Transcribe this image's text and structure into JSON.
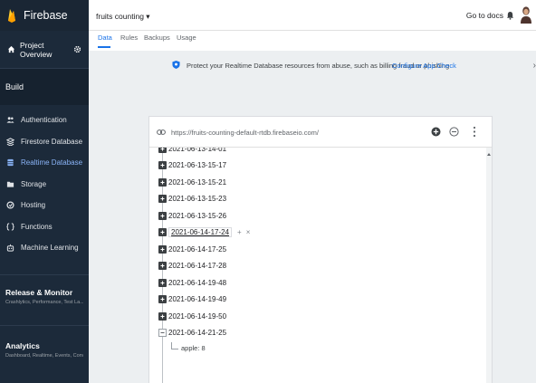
{
  "sidebar": {
    "brand": "Firebase",
    "project_overview": "Project Overview",
    "build_title": "Build",
    "items": [
      {
        "label": "Authentication",
        "icon": "people-icon"
      },
      {
        "label": "Firestore Database",
        "icon": "firestore-icon"
      },
      {
        "label": "Realtime Database",
        "icon": "database-icon",
        "active": true
      },
      {
        "label": "Storage",
        "icon": "folder-icon"
      },
      {
        "label": "Hosting",
        "icon": "hosting-icon"
      },
      {
        "label": "Functions",
        "icon": "functions-icon"
      },
      {
        "label": "Machine Learning",
        "icon": "robot-icon"
      }
    ],
    "release": {
      "title": "Release & Monitor",
      "subtitle": "Crashlytics, Performance, Test La..."
    },
    "analytics": {
      "title": "Analytics",
      "subtitle": "Dashboard, Realtime, Events, Conv..."
    }
  },
  "topbar": {
    "project": "fruits counting",
    "docs": "Go to docs"
  },
  "tabs": [
    "Data",
    "Rules",
    "Backups",
    "Usage"
  ],
  "banner": {
    "text": "Protect your Realtime Database resources from abuse, such as billing fraud or phishing",
    "link": "Configure App Check",
    "close": "›"
  },
  "database": {
    "url": "https://fruits-counting-default-rtdb.firebaseio.com/",
    "nodes": [
      "2021-06-13-14-01",
      "2021-06-13-15-17",
      "2021-06-13-15-21",
      "2021-06-13-15-23",
      "2021-06-13-15-26",
      "2021-06-14-17-24",
      "2021-06-14-17-25",
      "2021-06-14-17-28",
      "2021-06-14-19-48",
      "2021-06-14-19-49",
      "2021-06-14-19-50",
      "2021-06-14-21-25"
    ],
    "selected_actions": {
      "add": "+",
      "remove": "×"
    },
    "leaf": "apple: 8"
  },
  "colors": {
    "sidebar_bg": "#1c2a3a",
    "accent": "#1a73e8",
    "active_nav": "#8ab4f8"
  }
}
